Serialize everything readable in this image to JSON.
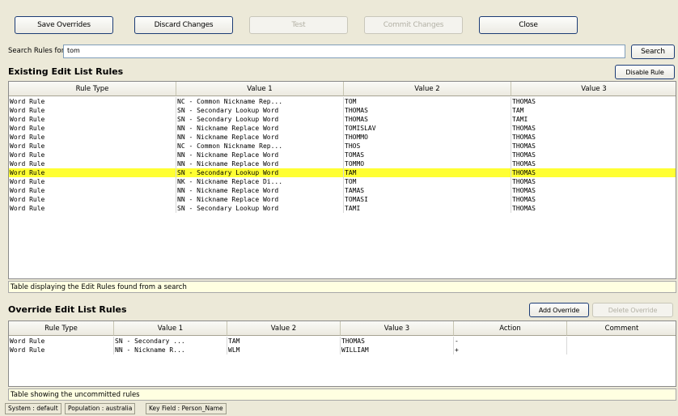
{
  "toolbar": {
    "save_label": "Save Overrides",
    "discard_label": "Discard Changes",
    "test_label": "Test",
    "commit_label": "Commit Changes",
    "close_label": "Close"
  },
  "search": {
    "label": "Search Rules for",
    "value": "tom",
    "button": "Search"
  },
  "existing": {
    "title": "Existing Edit List Rules",
    "disable_label": "Disable Rule",
    "columns": [
      "Rule Type",
      "Value 1",
      "Value 2",
      "Value 3"
    ],
    "rows": [
      [
        "Word Rule",
        "NC - Common Nickname Rep...",
        "TOM",
        "THOMAS"
      ],
      [
        "Word Rule",
        "SN - Secondary Lookup Word",
        "THOMAS",
        "TAM"
      ],
      [
        "Word Rule",
        "SN - Secondary Lookup Word",
        "THOMAS",
        "TAMI"
      ],
      [
        "Word Rule",
        "NN - Nickname Replace Word",
        "TOMISLAV",
        "THOMAS"
      ],
      [
        "Word Rule",
        "NN - Nickname Replace Word",
        "THOMMO",
        "THOMAS"
      ],
      [
        "Word Rule",
        "NC - Common Nickname Rep...",
        "THOS",
        "THOMAS"
      ],
      [
        "Word Rule",
        "NN - Nickname Replace Word",
        "TOMAS",
        "THOMAS"
      ],
      [
        "Word Rule",
        "NN - Nickname Replace Word",
        "TOMMO",
        "THOMAS"
      ],
      [
        "Word Rule",
        "SN - Secondary Lookup Word",
        "TAM",
        "THOMAS"
      ],
      [
        "Word Rule",
        "NK - Nickname Replace Di...",
        "TOM",
        "THOMAS"
      ],
      [
        "Word Rule",
        "NN - Nickname Replace Word",
        "TAMAS",
        "THOMAS"
      ],
      [
        "Word Rule",
        "NN - Nickname Replace Word",
        "TOMASI",
        "THOMAS"
      ],
      [
        "Word Rule",
        "SN - Secondary Lookup Word",
        "TAMI",
        "THOMAS"
      ]
    ],
    "caption": "Table displaying the Edit Rules found from a search"
  },
  "override": {
    "title": "Override Edit List Rules",
    "add_label": "Add Override",
    "delete_label": "Delete Override",
    "columns": [
      "Rule Type",
      "Value 1",
      "Value 2",
      "Value 3",
      "Action",
      "Comment"
    ],
    "rows": [
      [
        "Word Rule",
        "SN - Secondary ...",
        "TAM",
        "THOMAS",
        "-",
        ""
      ],
      [
        "Word Rule",
        "NN - Nickname R...",
        "WLM",
        "WILLIAM",
        "+",
        ""
      ]
    ],
    "caption": "Table showing the uncommitted rules"
  },
  "statusbar": {
    "system": "System : default",
    "population": "Population : australia",
    "keyfield": "Key Field : Person_Name"
  },
  "colors": {
    "background": "#ece9d8",
    "selected_row": "#ffff33",
    "caption_bg": "#ffffe1",
    "button_border": "#1c3c75"
  }
}
